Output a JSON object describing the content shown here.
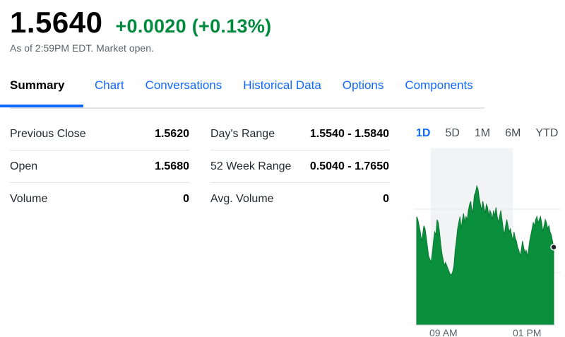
{
  "quote": {
    "price": "1.5640",
    "change": "+0.0020 (+0.13%)",
    "as_of": "As of 2:59PM EDT. Market open."
  },
  "tabs": [
    {
      "label": "Summary",
      "active": true
    },
    {
      "label": "Chart"
    },
    {
      "label": "Conversations"
    },
    {
      "label": "Historical Data"
    },
    {
      "label": "Options"
    },
    {
      "label": "Components"
    }
  ],
  "stats_left": [
    {
      "label": "Previous Close",
      "value": "1.5620"
    },
    {
      "label": "Open",
      "value": "1.5680"
    },
    {
      "label": "Volume",
      "value": "0"
    }
  ],
  "stats_right": [
    {
      "label": "Day's Range",
      "value": "1.5540 - 1.5840"
    },
    {
      "label": "52 Week Range",
      "value": "0.5040 - 1.7650"
    },
    {
      "label": "Avg. Volume",
      "value": "0"
    }
  ],
  "chart_ranges": [
    "1D",
    "5D",
    "1M",
    "6M",
    "YTD"
  ],
  "chart_ranges_active": "1D",
  "colors": {
    "accent": "#0f69ff",
    "positive": "#008a3d",
    "area": "#0a8f3c"
  },
  "chart_data": {
    "type": "area",
    "series_active_range": "1D",
    "x_tick_labels": [
      "09 AM",
      "01 PM"
    ],
    "values": [
      1.574,
      1.573,
      1.571,
      1.569,
      1.566,
      1.568,
      1.571,
      1.57,
      1.567,
      1.564,
      1.561,
      1.56,
      1.559,
      1.562,
      1.566,
      1.569,
      1.568,
      1.573,
      1.572,
      1.569,
      1.565,
      1.562,
      1.56,
      1.558,
      1.559,
      1.558,
      1.557,
      1.556,
      1.555,
      1.555,
      1.556,
      1.558,
      1.563,
      1.566,
      1.57,
      1.572,
      1.574,
      1.57,
      1.573,
      1.575,
      1.572,
      1.574,
      1.573,
      1.576,
      1.578,
      1.579,
      1.575,
      1.577,
      1.581,
      1.582,
      1.584,
      1.583,
      1.58,
      1.578,
      1.576,
      1.579,
      1.577,
      1.575,
      1.578,
      1.577,
      1.574,
      1.576,
      1.575,
      1.573,
      1.576,
      1.574,
      1.577,
      1.574,
      1.572,
      1.574,
      1.576,
      1.573,
      1.57,
      1.568,
      1.571,
      1.573,
      1.571,
      1.569,
      1.57,
      1.568,
      1.566,
      1.569,
      1.567,
      1.566,
      1.564,
      1.563,
      1.561,
      1.563,
      1.566,
      1.564,
      1.562,
      1.563,
      1.561,
      1.563,
      1.566,
      1.568,
      1.57,
      1.572,
      1.571,
      1.573,
      1.574,
      1.572,
      1.573,
      1.574,
      1.572,
      1.569,
      1.571,
      1.573,
      1.572,
      1.57,
      1.571,
      1.569,
      1.568,
      1.566,
      1.564
    ]
  }
}
